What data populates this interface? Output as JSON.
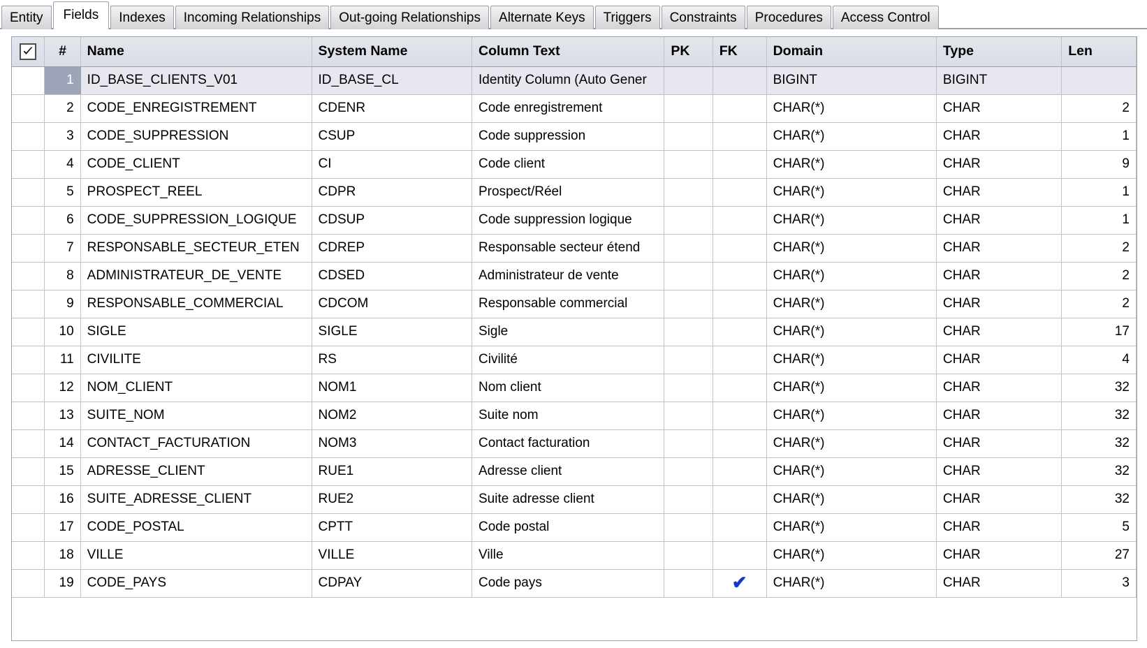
{
  "tabs": [
    {
      "label": "Entity",
      "active": false
    },
    {
      "label": "Fields",
      "active": true
    },
    {
      "label": "Indexes",
      "active": false
    },
    {
      "label": "Incoming Relationships",
      "active": false
    },
    {
      "label": "Out-going Relationships",
      "active": false
    },
    {
      "label": "Alternate Keys",
      "active": false
    },
    {
      "label": "Triggers",
      "active": false
    },
    {
      "label": "Constraints",
      "active": false
    },
    {
      "label": "Procedures",
      "active": false
    },
    {
      "label": "Access Control",
      "active": false
    }
  ],
  "grid": {
    "select_all_checked": true,
    "select_all_icon": "checkmark-icon",
    "fk_icon": "checkmark-icon",
    "accent_checkmark_color": "#1837c9",
    "selected_row_index": 1,
    "columns": [
      {
        "key": "select",
        "label": ""
      },
      {
        "key": "num",
        "label": "#"
      },
      {
        "key": "name",
        "label": "Name"
      },
      {
        "key": "system",
        "label": "System Name"
      },
      {
        "key": "text",
        "label": "Column Text"
      },
      {
        "key": "pk",
        "label": "PK"
      },
      {
        "key": "fk",
        "label": "FK"
      },
      {
        "key": "domain",
        "label": "Domain"
      },
      {
        "key": "type",
        "label": "Type"
      },
      {
        "key": "len",
        "label": "Len"
      }
    ],
    "rows": [
      {
        "num": "1",
        "name": "ID_BASE_CLIENTS_V01",
        "system": "ID_BASE_CL",
        "text": "Identity Column (Auto Gener",
        "pk": "",
        "fk": "",
        "domain": "BIGINT",
        "type": "BIGINT",
        "len": "",
        "selected": true
      },
      {
        "num": "2",
        "name": "CODE_ENREGISTREMENT",
        "system": "CDENR",
        "text": "Code enregistrement",
        "pk": "",
        "fk": "",
        "domain": "CHAR(*)",
        "type": "CHAR",
        "len": "2",
        "selected": false
      },
      {
        "num": "3",
        "name": "CODE_SUPPRESSION",
        "system": "CSUP",
        "text": "Code suppression",
        "pk": "",
        "fk": "",
        "domain": "CHAR(*)",
        "type": "CHAR",
        "len": "1",
        "selected": false
      },
      {
        "num": "4",
        "name": "CODE_CLIENT",
        "system": "CI",
        "text": "Code client",
        "pk": "",
        "fk": "",
        "domain": "CHAR(*)",
        "type": "CHAR",
        "len": "9",
        "selected": false
      },
      {
        "num": "5",
        "name": "PROSPECT_REEL",
        "system": "CDPR",
        "text": "Prospect/Réel",
        "pk": "",
        "fk": "",
        "domain": "CHAR(*)",
        "type": "CHAR",
        "len": "1",
        "selected": false
      },
      {
        "num": "6",
        "name": "CODE_SUPPRESSION_LOGIQUE",
        "system": "CDSUP",
        "text": "Code suppression logique",
        "pk": "",
        "fk": "",
        "domain": "CHAR(*)",
        "type": "CHAR",
        "len": "1",
        "selected": false
      },
      {
        "num": "7",
        "name": "RESPONSABLE_SECTEUR_ETEN",
        "system": "CDREP",
        "text": "Responsable secteur étend",
        "pk": "",
        "fk": "",
        "domain": "CHAR(*)",
        "type": "CHAR",
        "len": "2",
        "selected": false
      },
      {
        "num": "8",
        "name": "ADMINISTRATEUR_DE_VENTE",
        "system": "CDSED",
        "text": "Administrateur de vente",
        "pk": "",
        "fk": "",
        "domain": "CHAR(*)",
        "type": "CHAR",
        "len": "2",
        "selected": false
      },
      {
        "num": "9",
        "name": "RESPONSABLE_COMMERCIAL",
        "system": "CDCOM",
        "text": "Responsable commercial",
        "pk": "",
        "fk": "",
        "domain": "CHAR(*)",
        "type": "CHAR",
        "len": "2",
        "selected": false
      },
      {
        "num": "10",
        "name": "SIGLE",
        "system": "SIGLE",
        "text": "Sigle",
        "pk": "",
        "fk": "",
        "domain": "CHAR(*)",
        "type": "CHAR",
        "len": "17",
        "selected": false
      },
      {
        "num": "11",
        "name": "CIVILITE",
        "system": "RS",
        "text": "Civilité",
        "pk": "",
        "fk": "",
        "domain": "CHAR(*)",
        "type": "CHAR",
        "len": "4",
        "selected": false
      },
      {
        "num": "12",
        "name": "NOM_CLIENT",
        "system": "NOM1",
        "text": "Nom client",
        "pk": "",
        "fk": "",
        "domain": "CHAR(*)",
        "type": "CHAR",
        "len": "32",
        "selected": false
      },
      {
        "num": "13",
        "name": "SUITE_NOM",
        "system": "NOM2",
        "text": "Suite nom",
        "pk": "",
        "fk": "",
        "domain": "CHAR(*)",
        "type": "CHAR",
        "len": "32",
        "selected": false
      },
      {
        "num": "14",
        "name": "CONTACT_FACTURATION",
        "system": "NOM3",
        "text": "Contact facturation",
        "pk": "",
        "fk": "",
        "domain": "CHAR(*)",
        "type": "CHAR",
        "len": "32",
        "selected": false
      },
      {
        "num": "15",
        "name": "ADRESSE_CLIENT",
        "system": "RUE1",
        "text": "Adresse client",
        "pk": "",
        "fk": "",
        "domain": "CHAR(*)",
        "type": "CHAR",
        "len": "32",
        "selected": false
      },
      {
        "num": "16",
        "name": "SUITE_ADRESSE_CLIENT",
        "system": "RUE2",
        "text": "Suite adresse client",
        "pk": "",
        "fk": "",
        "domain": "CHAR(*)",
        "type": "CHAR",
        "len": "32",
        "selected": false
      },
      {
        "num": "17",
        "name": "CODE_POSTAL",
        "system": "CPTT",
        "text": "Code postal",
        "pk": "",
        "fk": "",
        "domain": "CHAR(*)",
        "type": "CHAR",
        "len": "5",
        "selected": false
      },
      {
        "num": "18",
        "name": "VILLE",
        "system": "VILLE",
        "text": "Ville",
        "pk": "",
        "fk": "",
        "domain": "CHAR(*)",
        "type": "CHAR",
        "len": "27",
        "selected": false
      },
      {
        "num": "19",
        "name": "CODE_PAYS",
        "system": "CDPAY",
        "text": "Code pays",
        "pk": "",
        "fk": "✔",
        "domain": "CHAR(*)",
        "type": "CHAR",
        "len": "3",
        "selected": false
      }
    ]
  }
}
